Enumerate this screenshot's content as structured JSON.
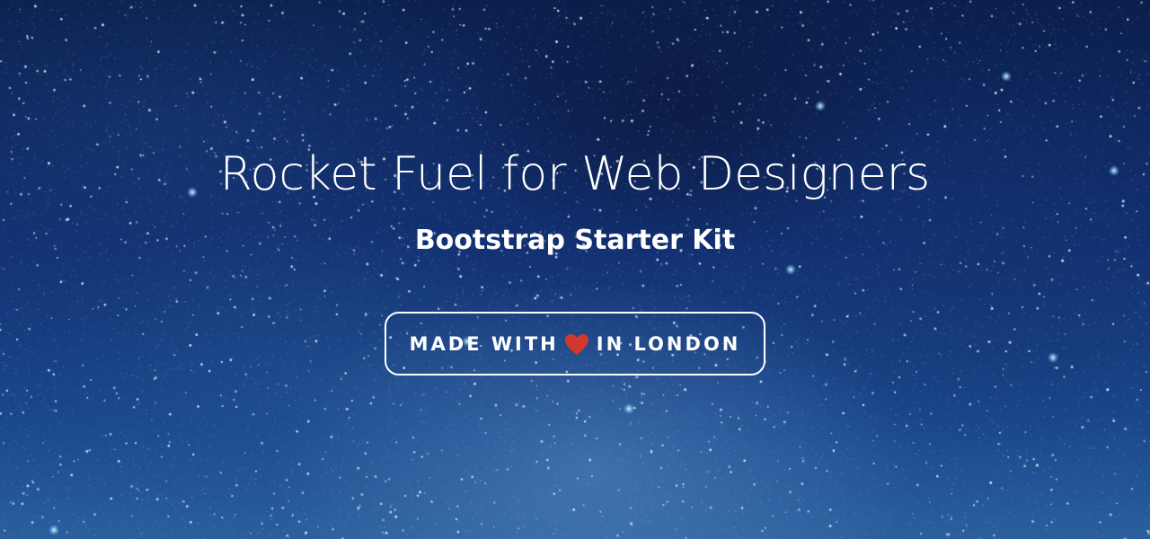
{
  "hero": {
    "title": "Rocket Fuel for Web Designers",
    "subtitle": "Bootstrap Starter Kit",
    "badge": {
      "text_before": "MADE WITH",
      "icon": "heart-icon",
      "text_after": "IN LONDON"
    }
  },
  "colors": {
    "heart": "#d0392b",
    "text": "#ffffff",
    "background_top": "#0b1f4d",
    "background_bottom": "#2a5f9d"
  }
}
